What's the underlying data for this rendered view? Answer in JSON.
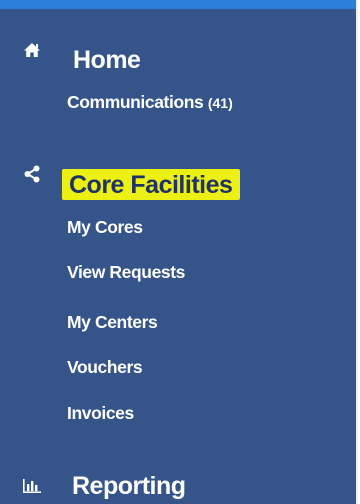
{
  "nav": {
    "home": {
      "title": "Home",
      "icon": "home-icon",
      "items": [
        {
          "label": "Communications",
          "count": "(41)"
        }
      ]
    },
    "core_facilities": {
      "title": "Core Facilities",
      "icon": "share-icon",
      "highlight_color": "#ecf013",
      "items": [
        {
          "label": "My Cores"
        },
        {
          "label": "View Requests"
        },
        {
          "label": "My Centers"
        },
        {
          "label": "Vouchers"
        },
        {
          "label": "Invoices"
        }
      ]
    },
    "reporting": {
      "title": "Reporting",
      "icon": "bar-chart-icon"
    }
  },
  "colors": {
    "sidebar_bg": "#34548a",
    "accent_bar": "#2d7fdc",
    "text": "#ffffff"
  }
}
